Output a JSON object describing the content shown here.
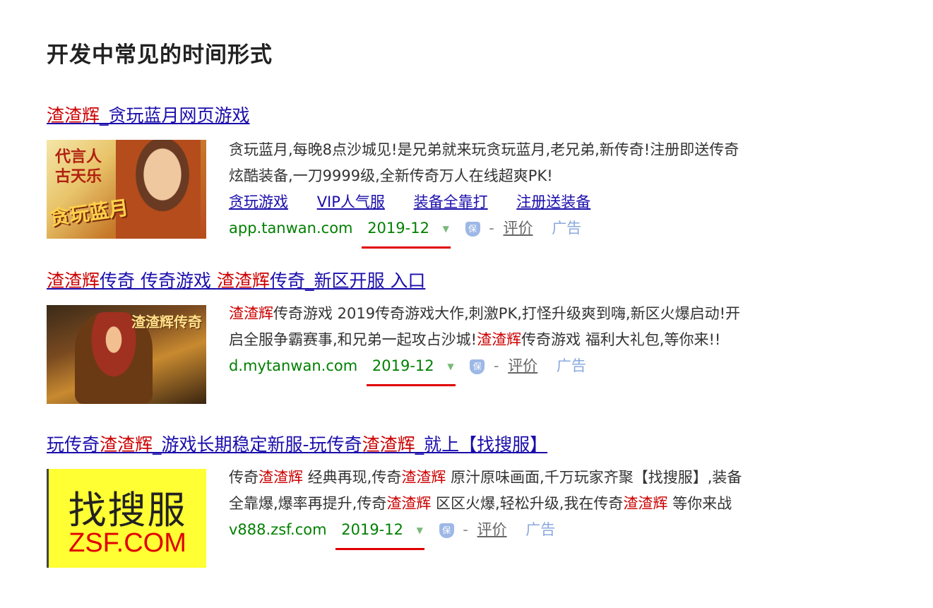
{
  "page_title": "开发中常见的时间形式",
  "results": [
    {
      "title_parts": [
        {
          "text": "渣渣辉",
          "hl": true
        },
        {
          "text": "_贪玩蓝月网页游戏",
          "hl": false
        }
      ],
      "thumb": {
        "spokesman": "代言人",
        "name": "古天乐",
        "logo": "贪玩蓝月"
      },
      "desc_parts": [
        {
          "text": "贪玩蓝月,每晚8点沙城见!是兄弟就来玩贪玩蓝月,老兄弟,新传奇!注册即送传奇炫酷装备,一刀9999级,全新传奇万人在线超爽PK!",
          "hl": false
        }
      ],
      "links": [
        "贪玩游戏",
        "VIP人气服",
        "装备全靠打",
        "注册送装备"
      ],
      "url": "app.tanwan.com",
      "date": "2019-12",
      "eval_label": "评价",
      "ad_label": "广告"
    },
    {
      "title_parts": [
        {
          "text": "渣渣辉",
          "hl": true
        },
        {
          "text": "传奇 传奇游戏 ",
          "hl": false
        },
        {
          "text": "渣渣辉",
          "hl": true
        },
        {
          "text": "传奇_新区开服 入口",
          "hl": false
        }
      ],
      "thumb": {
        "logo": "渣渣辉传奇"
      },
      "desc_parts": [
        {
          "text": "渣渣辉",
          "hl": true
        },
        {
          "text": "传奇游戏 2019传奇游戏大作,刺激PK,打怪升级爽到嗨,新区火爆启动!开启全服争霸赛事,和兄弟一起攻占沙城!",
          "hl": false
        },
        {
          "text": "渣渣辉",
          "hl": true
        },
        {
          "text": "传奇游戏 福利大礼包,等你来!!",
          "hl": false
        }
      ],
      "links": [],
      "url": "d.mytanwan.com",
      "date": "2019-12",
      "eval_label": "评价",
      "ad_label": "广告"
    },
    {
      "title_parts": [
        {
          "text": "玩传奇",
          "hl": false
        },
        {
          "text": "渣渣辉",
          "hl": true
        },
        {
          "text": "_游戏长期稳定新服-玩传奇",
          "hl": false
        },
        {
          "text": "渣渣辉",
          "hl": true
        },
        {
          "text": "_就上【找搜服】",
          "hl": false
        }
      ],
      "thumb": {
        "big": "找搜服",
        "small": "ZSF.COM"
      },
      "desc_parts": [
        {
          "text": "传奇",
          "hl": false
        },
        {
          "text": "渣渣辉",
          "hl": true
        },
        {
          "text": " 经典再现,传奇",
          "hl": false
        },
        {
          "text": "渣渣辉",
          "hl": true
        },
        {
          "text": " 原汁原味画面,千万玩家齐聚【找搜服】,装备全靠爆,爆率再提升,传奇",
          "hl": false
        },
        {
          "text": "渣渣辉",
          "hl": true
        },
        {
          "text": " 区区火爆,轻松升级,我在传奇",
          "hl": false
        },
        {
          "text": "渣渣辉",
          "hl": true
        },
        {
          "text": " 等你来战",
          "hl": false
        }
      ],
      "links": [],
      "url": "v888.zsf.com",
      "date": "2019-12",
      "eval_label": "评价",
      "ad_label": "广告"
    }
  ],
  "colors": {
    "highlight": "#cc0000",
    "link": "#1a0dab",
    "url": "#008000",
    "underline_mark": "#e00000"
  },
  "icons": {
    "caret": "caret-down-icon",
    "shield": "shield-icon"
  }
}
